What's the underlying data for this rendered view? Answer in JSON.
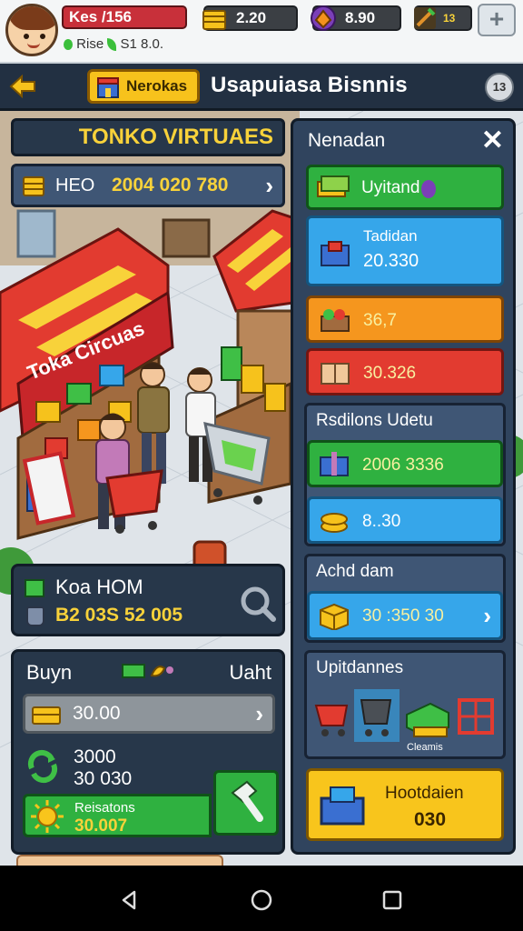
{
  "status": {
    "player_name": "Kes /156",
    "sub_text": "Rise",
    "sub_value": "S1 8.0."
  },
  "resources": [
    {
      "icon": "gold-bars-icon",
      "value": "2.20"
    },
    {
      "icon": "gem-purse-icon",
      "value": "8.90"
    },
    {
      "icon": "hammer-wrench-icon",
      "value": "13"
    }
  ],
  "header": {
    "badge_label": "Nerokas",
    "title": "Usapuiasa Bisnnis",
    "level": "13"
  },
  "store": {
    "title": "TONKO VIRTUAES",
    "info_label": "HEO",
    "info_value": "2004 020 780",
    "shop_sign": "Toka Circuas"
  },
  "stats": {
    "line1": "Koa HOM",
    "line2": "B2 03S  52 005"
  },
  "buy": {
    "title": "Buyn",
    "title_right": "Uaht",
    "row_value": "30.00",
    "stack_a": "3000",
    "stack_b": "30 030",
    "green_label": "Reisatons",
    "green_value": "30.007"
  },
  "right_panel": {
    "title": "Nenadan",
    "upgrade_label": "Uyitand",
    "blue_label": "Tadidan",
    "blue_value": "20.330",
    "orange_value": "36,7",
    "red_value": "30.326",
    "section1_title": "Rsdilons Udetu",
    "s1_green_value": "2006 3336",
    "s1_blue_value": "8..30",
    "section2_title": "Achd dam",
    "s2_blue_value": "30 :350 30",
    "section3_title": "Upitdannes",
    "s3_caption": "Cleamis",
    "yellow_label": "Hootdaien",
    "yellow_value": "030"
  },
  "colors": {
    "panel": "#27374a",
    "accent_yellow": "#f8d23a",
    "green": "#2fb140",
    "blue": "#36a6ea",
    "orange": "#f5961e",
    "red": "#e23b30"
  }
}
